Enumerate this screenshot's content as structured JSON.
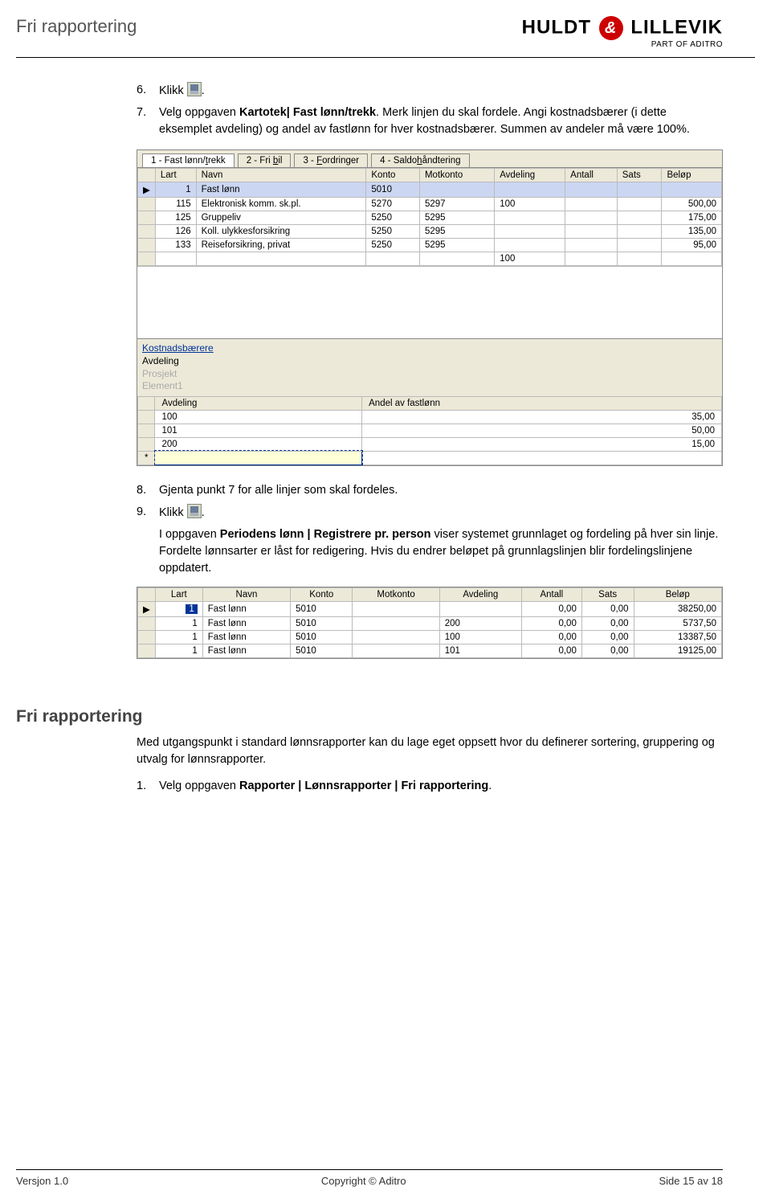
{
  "header": {
    "title": "Fri rapportering"
  },
  "brand": {
    "left": "HULDT",
    "amp": "&",
    "right": "LILLEVIK",
    "sub": "PART OF ADITRO"
  },
  "steps": {
    "s6": {
      "num": "6.",
      "text": "Klikk",
      "icon_dot": "."
    },
    "s7": {
      "num": "7.",
      "text": "Velg oppgaven ",
      "bold": "Kartotek| Fast lønn/trekk",
      "tail": ". Merk linjen du skal fordele. Angi kostnadsbærer (i dette eksemplet avdeling) og andel av fastlønn for hver kostnadsbærer. Summen av andeler må være 100%."
    },
    "s8": {
      "num": "8.",
      "text": "Gjenta punkt 7 for alle linjer som skal fordeles."
    },
    "s9": {
      "num": "9.",
      "text": "Klikk",
      "icon_dot": "."
    },
    "after9_a": "I oppgaven ",
    "after9_bold": "Periodens lønn | Registrere pr. person",
    "after9_b": " viser systemet grunnlaget og fordeling på hver sin linje. Fordelte lønnsarter er låst for redigering. Hvis du endrer beløpet på grunnlagslinjen blir fordelingslinjene oppdatert."
  },
  "screenshot1": {
    "tabs": [
      {
        "label_pre": "1 - Fast lønn/",
        "u": "t",
        "label_post": "rekk",
        "active": true
      },
      {
        "label_pre": "2 - Fri ",
        "u": "b",
        "label_post": "il",
        "active": false
      },
      {
        "label_pre": "3 - ",
        "u": "F",
        "label_post": "ordringer",
        "active": false
      },
      {
        "label_pre": "4 - Saldo",
        "u": "h",
        "label_post": "åndtering",
        "active": false
      }
    ],
    "cols": [
      "Lart",
      "Navn",
      "Konto",
      "Motkonto",
      "Avdeling",
      "Antall",
      "Sats",
      "Beløp"
    ],
    "rows": [
      {
        "mark": "▶",
        "lart": "1",
        "navn": "Fast lønn",
        "konto": "5010",
        "mot": "",
        "avd": "",
        "ant": "",
        "sats": "",
        "bel": "",
        "selected": true
      },
      {
        "mark": "",
        "lart": "115",
        "navn": "Elektronisk komm. sk.pl.",
        "konto": "5270",
        "mot": "5297",
        "avd": "100",
        "ant": "",
        "sats": "",
        "bel": "500,00"
      },
      {
        "mark": "",
        "lart": "125",
        "navn": "Gruppeliv",
        "konto": "5250",
        "mot": "5295",
        "avd": "",
        "ant": "",
        "sats": "",
        "bel": "175,00"
      },
      {
        "mark": "",
        "lart": "126",
        "navn": "Koll. ulykkesforsikring",
        "konto": "5250",
        "mot": "5295",
        "avd": "",
        "ant": "",
        "sats": "",
        "bel": "135,00"
      },
      {
        "mark": "",
        "lart": "133",
        "navn": "Reiseforsikring, privat",
        "konto": "5250",
        "mot": "5295",
        "avd": "",
        "ant": "",
        "sats": "",
        "bel": "95,00"
      },
      {
        "mark": "",
        "lart": "",
        "navn": "",
        "konto": "",
        "mot": "",
        "avd": "100",
        "ant": "",
        "sats": "",
        "bel": ""
      }
    ],
    "kb_title": "Kostnadsbærere",
    "kb_items": [
      {
        "label": "Avdeling",
        "cls": "act"
      },
      {
        "label": "Prosjekt",
        "cls": "dim"
      },
      {
        "label": "Element1",
        "cls": "dim"
      }
    ],
    "andel_cols": [
      "Avdeling",
      "Andel av fastlønn"
    ],
    "andel_rows": [
      {
        "mark": "",
        "avd": "100",
        "andel": "35,00"
      },
      {
        "mark": "",
        "avd": "101",
        "andel": "50,00"
      },
      {
        "mark": "",
        "avd": "200",
        "andel": "15,00"
      },
      {
        "mark": "*",
        "avd": "",
        "andel": "",
        "cursor": true
      }
    ]
  },
  "screenshot2": {
    "cols": [
      "Lart",
      "Navn",
      "Konto",
      "Motkonto",
      "Avdeling",
      "Antall",
      "Sats",
      "Beløp"
    ],
    "rows": [
      {
        "mark": "▶",
        "lart": "1",
        "navn": "Fast lønn",
        "konto": "5010",
        "mot": "",
        "avd": "",
        "ant": "0,00",
        "sats": "0,00",
        "bel": "38250,00",
        "sel": true
      },
      {
        "mark": "",
        "lart": "1",
        "navn": "Fast lønn",
        "konto": "5010",
        "mot": "",
        "avd": "200",
        "ant": "0,00",
        "sats": "0,00",
        "bel": "5737,50"
      },
      {
        "mark": "",
        "lart": "1",
        "navn": "Fast lønn",
        "konto": "5010",
        "mot": "",
        "avd": "100",
        "ant": "0,00",
        "sats": "0,00",
        "bel": "13387,50"
      },
      {
        "mark": "",
        "lart": "1",
        "navn": "Fast lønn",
        "konto": "5010",
        "mot": "",
        "avd": "101",
        "ant": "0,00",
        "sats": "0,00",
        "bel": "19125,00"
      }
    ]
  },
  "section2": {
    "heading": "Fri rapportering",
    "para": "Med utgangspunkt i standard lønnsrapporter kan du lage eget oppsett hvor du definerer sortering, gruppering og utvalg for lønnsrapporter.",
    "step1_num": "1.",
    "step1_text": "Velg oppgaven ",
    "step1_bold": "Rapporter | Lønnsrapporter | Fri rapportering",
    "step1_dot": "."
  },
  "footer": {
    "left": "Versjon 1.0",
    "center": "Copyright © Aditro",
    "right": "Side 15 av 18"
  }
}
